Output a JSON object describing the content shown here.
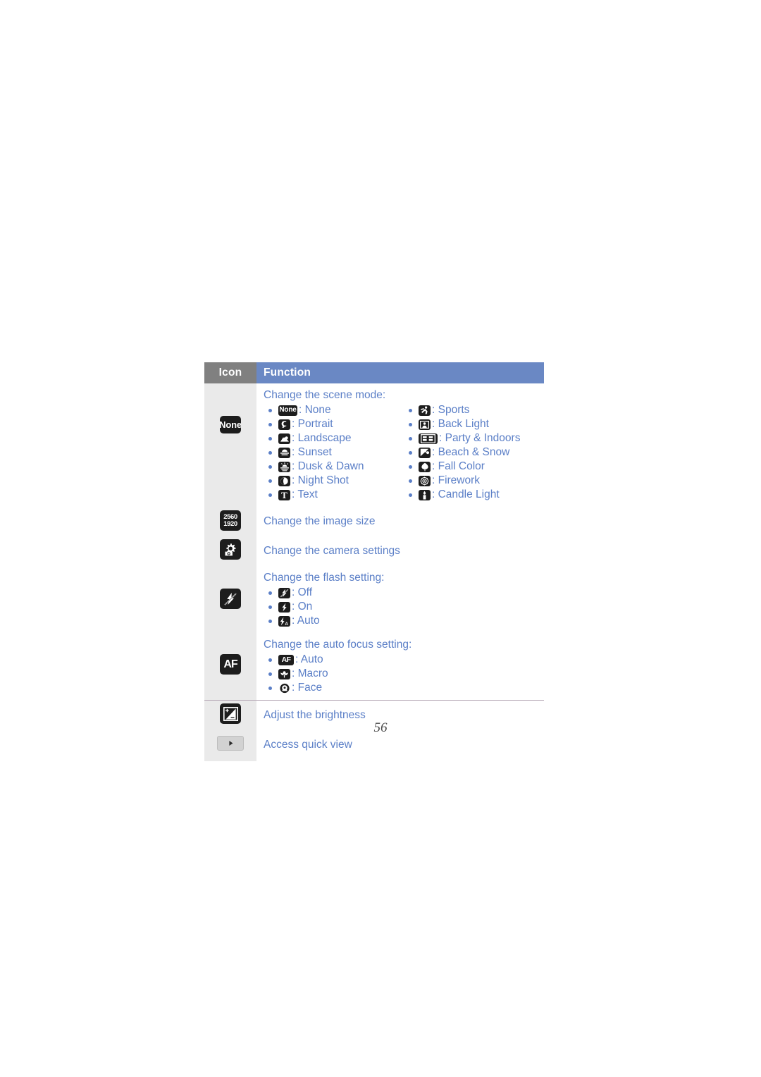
{
  "page": {
    "number": "56"
  },
  "table": {
    "headers": {
      "icon": "Icon",
      "function": "Function"
    },
    "rows": [
      {
        "icon_name": "scene-mode-none-icon",
        "icon_glyph": "none-badge",
        "icon_text": "None",
        "title": "Change the scene mode:",
        "options_left": [
          {
            "icon": "none-badge",
            "icon_text": "None",
            "label": ": None"
          },
          {
            "icon": "portrait-icon",
            "label": ": Portrait"
          },
          {
            "icon": "landscape-icon",
            "label": ": Landscape"
          },
          {
            "icon": "sunset-icon",
            "label": ": Sunset"
          },
          {
            "icon": "dusk-dawn-icon",
            "label": ": Dusk & Dawn"
          },
          {
            "icon": "night-shot-icon",
            "label": ": Night Shot"
          },
          {
            "icon": "text-icon",
            "icon_text": "T",
            "label": ": Text"
          }
        ],
        "options_right": [
          {
            "icon": "sports-icon",
            "label": ": Sports"
          },
          {
            "icon": "back-light-icon",
            "label": ": Back Light"
          },
          {
            "icon": "party-indoors-icon",
            "label": ": Party & Indoors"
          },
          {
            "icon": "beach-snow-icon",
            "label": ": Beach & Snow"
          },
          {
            "icon": "fall-color-icon",
            "label": ": Fall Color"
          },
          {
            "icon": "firework-icon",
            "label": ": Firework"
          },
          {
            "icon": "candle-light-icon",
            "label": ": Candle Light"
          }
        ]
      },
      {
        "icon_name": "image-size-icon",
        "icon_glyph": "size-badge",
        "icon_text_line1": "2560",
        "icon_text_line2": "1920",
        "title": "Change the image size",
        "options_left": [],
        "options_right": []
      },
      {
        "icon_name": "camera-settings-icon",
        "icon_glyph": "gear-camera",
        "title": "Change the camera settings",
        "options_left": [],
        "options_right": []
      },
      {
        "icon_name": "flash-setting-icon",
        "icon_glyph": "flash-off",
        "title": "Change the flash setting:",
        "options_left": [
          {
            "icon": "flash-off-icon",
            "label": ": Off"
          },
          {
            "icon": "flash-on-icon",
            "label": ": On"
          },
          {
            "icon": "flash-auto-icon",
            "label": ": Auto"
          }
        ],
        "options_right": []
      },
      {
        "icon_name": "auto-focus-icon",
        "icon_glyph": "af-badge",
        "icon_text": "AF",
        "title": "Change the auto focus setting:",
        "options_left": [
          {
            "icon": "af-auto-icon",
            "icon_text": "AF",
            "label": ": Auto"
          },
          {
            "icon": "af-macro-icon",
            "label": ": Macro"
          },
          {
            "icon": "af-face-icon",
            "label": ": Face"
          }
        ],
        "options_right": []
      },
      {
        "icon_name": "brightness-icon",
        "icon_glyph": "exposure",
        "title": "Adjust the brightness",
        "options_left": [],
        "options_right": []
      },
      {
        "icon_name": "quick-view-icon",
        "icon_glyph": "play-triangle",
        "title": "Access quick view",
        "options_left": [],
        "options_right": []
      }
    ]
  },
  "colors": {
    "header_icon_bg": "#808080",
    "header_function_bg": "#6a88c4",
    "text_blue": "#5b7fc7",
    "icon_column_bg": "#eaeaea",
    "chip_bg": "#1d1d1d"
  }
}
